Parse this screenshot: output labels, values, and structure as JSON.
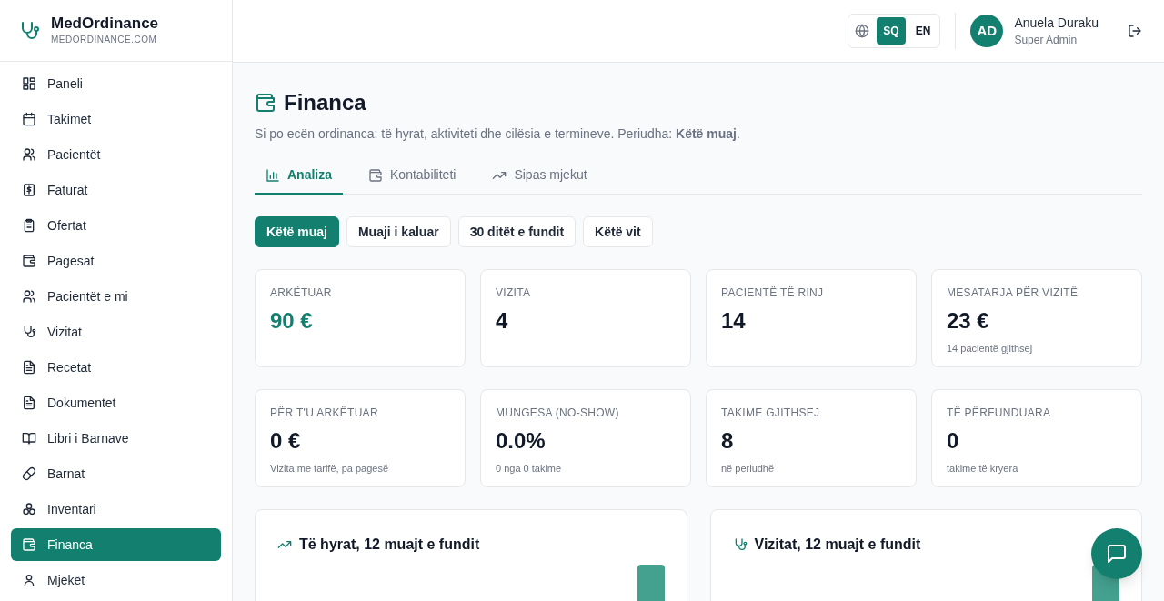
{
  "brand": {
    "name": "MedOrdinance",
    "domain": "MEDORDINANCE.COM"
  },
  "sidebar": {
    "items": [
      {
        "label": "Paneli",
        "kind": "grid",
        "selected": false
      },
      {
        "label": "Takimet",
        "kind": "calendar",
        "selected": false
      },
      {
        "label": "Pacientët",
        "kind": "users",
        "selected": false
      },
      {
        "label": "Faturat",
        "kind": "dollar",
        "selected": false
      },
      {
        "label": "Ofertat",
        "kind": "clipboard",
        "selected": false
      },
      {
        "label": "Pagesat",
        "kind": "wallet",
        "selected": false
      },
      {
        "label": "Pacientët e mi",
        "kind": "users",
        "selected": false
      },
      {
        "label": "Vizitat",
        "kind": "stethoscope",
        "selected": false
      },
      {
        "label": "Recetat",
        "kind": "file",
        "selected": false
      },
      {
        "label": "Dokumentet",
        "kind": "file",
        "selected": false
      },
      {
        "label": "Libri i Barnave",
        "kind": "book",
        "selected": false
      },
      {
        "label": "Barnat",
        "kind": "pill",
        "selected": false
      },
      {
        "label": "Inventari",
        "kind": "boxes",
        "selected": false
      },
      {
        "label": "Financa",
        "kind": "wallet",
        "selected": true
      },
      {
        "label": "Mjekët",
        "kind": "user",
        "selected": false
      }
    ]
  },
  "header": {
    "languages": [
      {
        "label": "SQ",
        "selected": true
      },
      {
        "label": "EN",
        "selected": false
      }
    ],
    "user": {
      "initials": "AD",
      "name": "Anuela Duraku",
      "role": "Super Admin"
    }
  },
  "page": {
    "title": "Financa",
    "subtitle": "Si po ecën ordinanca: të hyrat, aktiviteti dhe cilësia e termineve. Periudha: **Këtë muaj**.",
    "tabs": [
      {
        "label": "Analiza",
        "kind": "bars",
        "selected": true
      },
      {
        "label": "Kontabiliteti",
        "kind": "wallet",
        "selected": false
      },
      {
        "label": "Sipas mjekut",
        "kind": "trend",
        "selected": false
      }
    ],
    "periods": [
      {
        "label": "Këtë muaj",
        "selected": true
      },
      {
        "label": "Muaji i kaluar",
        "selected": false
      },
      {
        "label": "30 ditët e fundit",
        "selected": false
      },
      {
        "label": "Këtë vit",
        "selected": false
      }
    ],
    "stats": [
      {
        "label": "ARKËTUAR",
        "value": "90 €",
        "kind": "accent"
      },
      {
        "label": "VIZITA",
        "value": "4",
        "kind": "plain"
      },
      {
        "label": "PACIENTË TË RINJ",
        "value": "14",
        "kind": "plain"
      },
      {
        "label": "MESATARJA PËR VIZITË",
        "value": "23 €",
        "note": "14 pacientë gjithsej",
        "kind": "plain"
      },
      {
        "label": "PËR T'U ARKËTUAR",
        "value": "0 €",
        "note": "Vizita me tarifë, pa pagesë",
        "kind": "plain"
      },
      {
        "label": "MUNGESA (NO-SHOW)",
        "value": "0.0%",
        "note": "0 nga 0 takime",
        "kind": "plain"
      },
      {
        "label": "TAKIME GJITHSEJ",
        "value": "8",
        "note": "në periudhë",
        "kind": "plain"
      },
      {
        "label": "TË PËRFUNDUARA",
        "value": "0",
        "note": "takime të kryera",
        "kind": "plain"
      }
    ],
    "charts": [
      {
        "title": "Të hyrat, 12 muajt e fundit",
        "kind": "trend"
      },
      {
        "title": "Vizitat, 12 muajt e fundit",
        "kind": "stethoscope"
      }
    ]
  }
}
